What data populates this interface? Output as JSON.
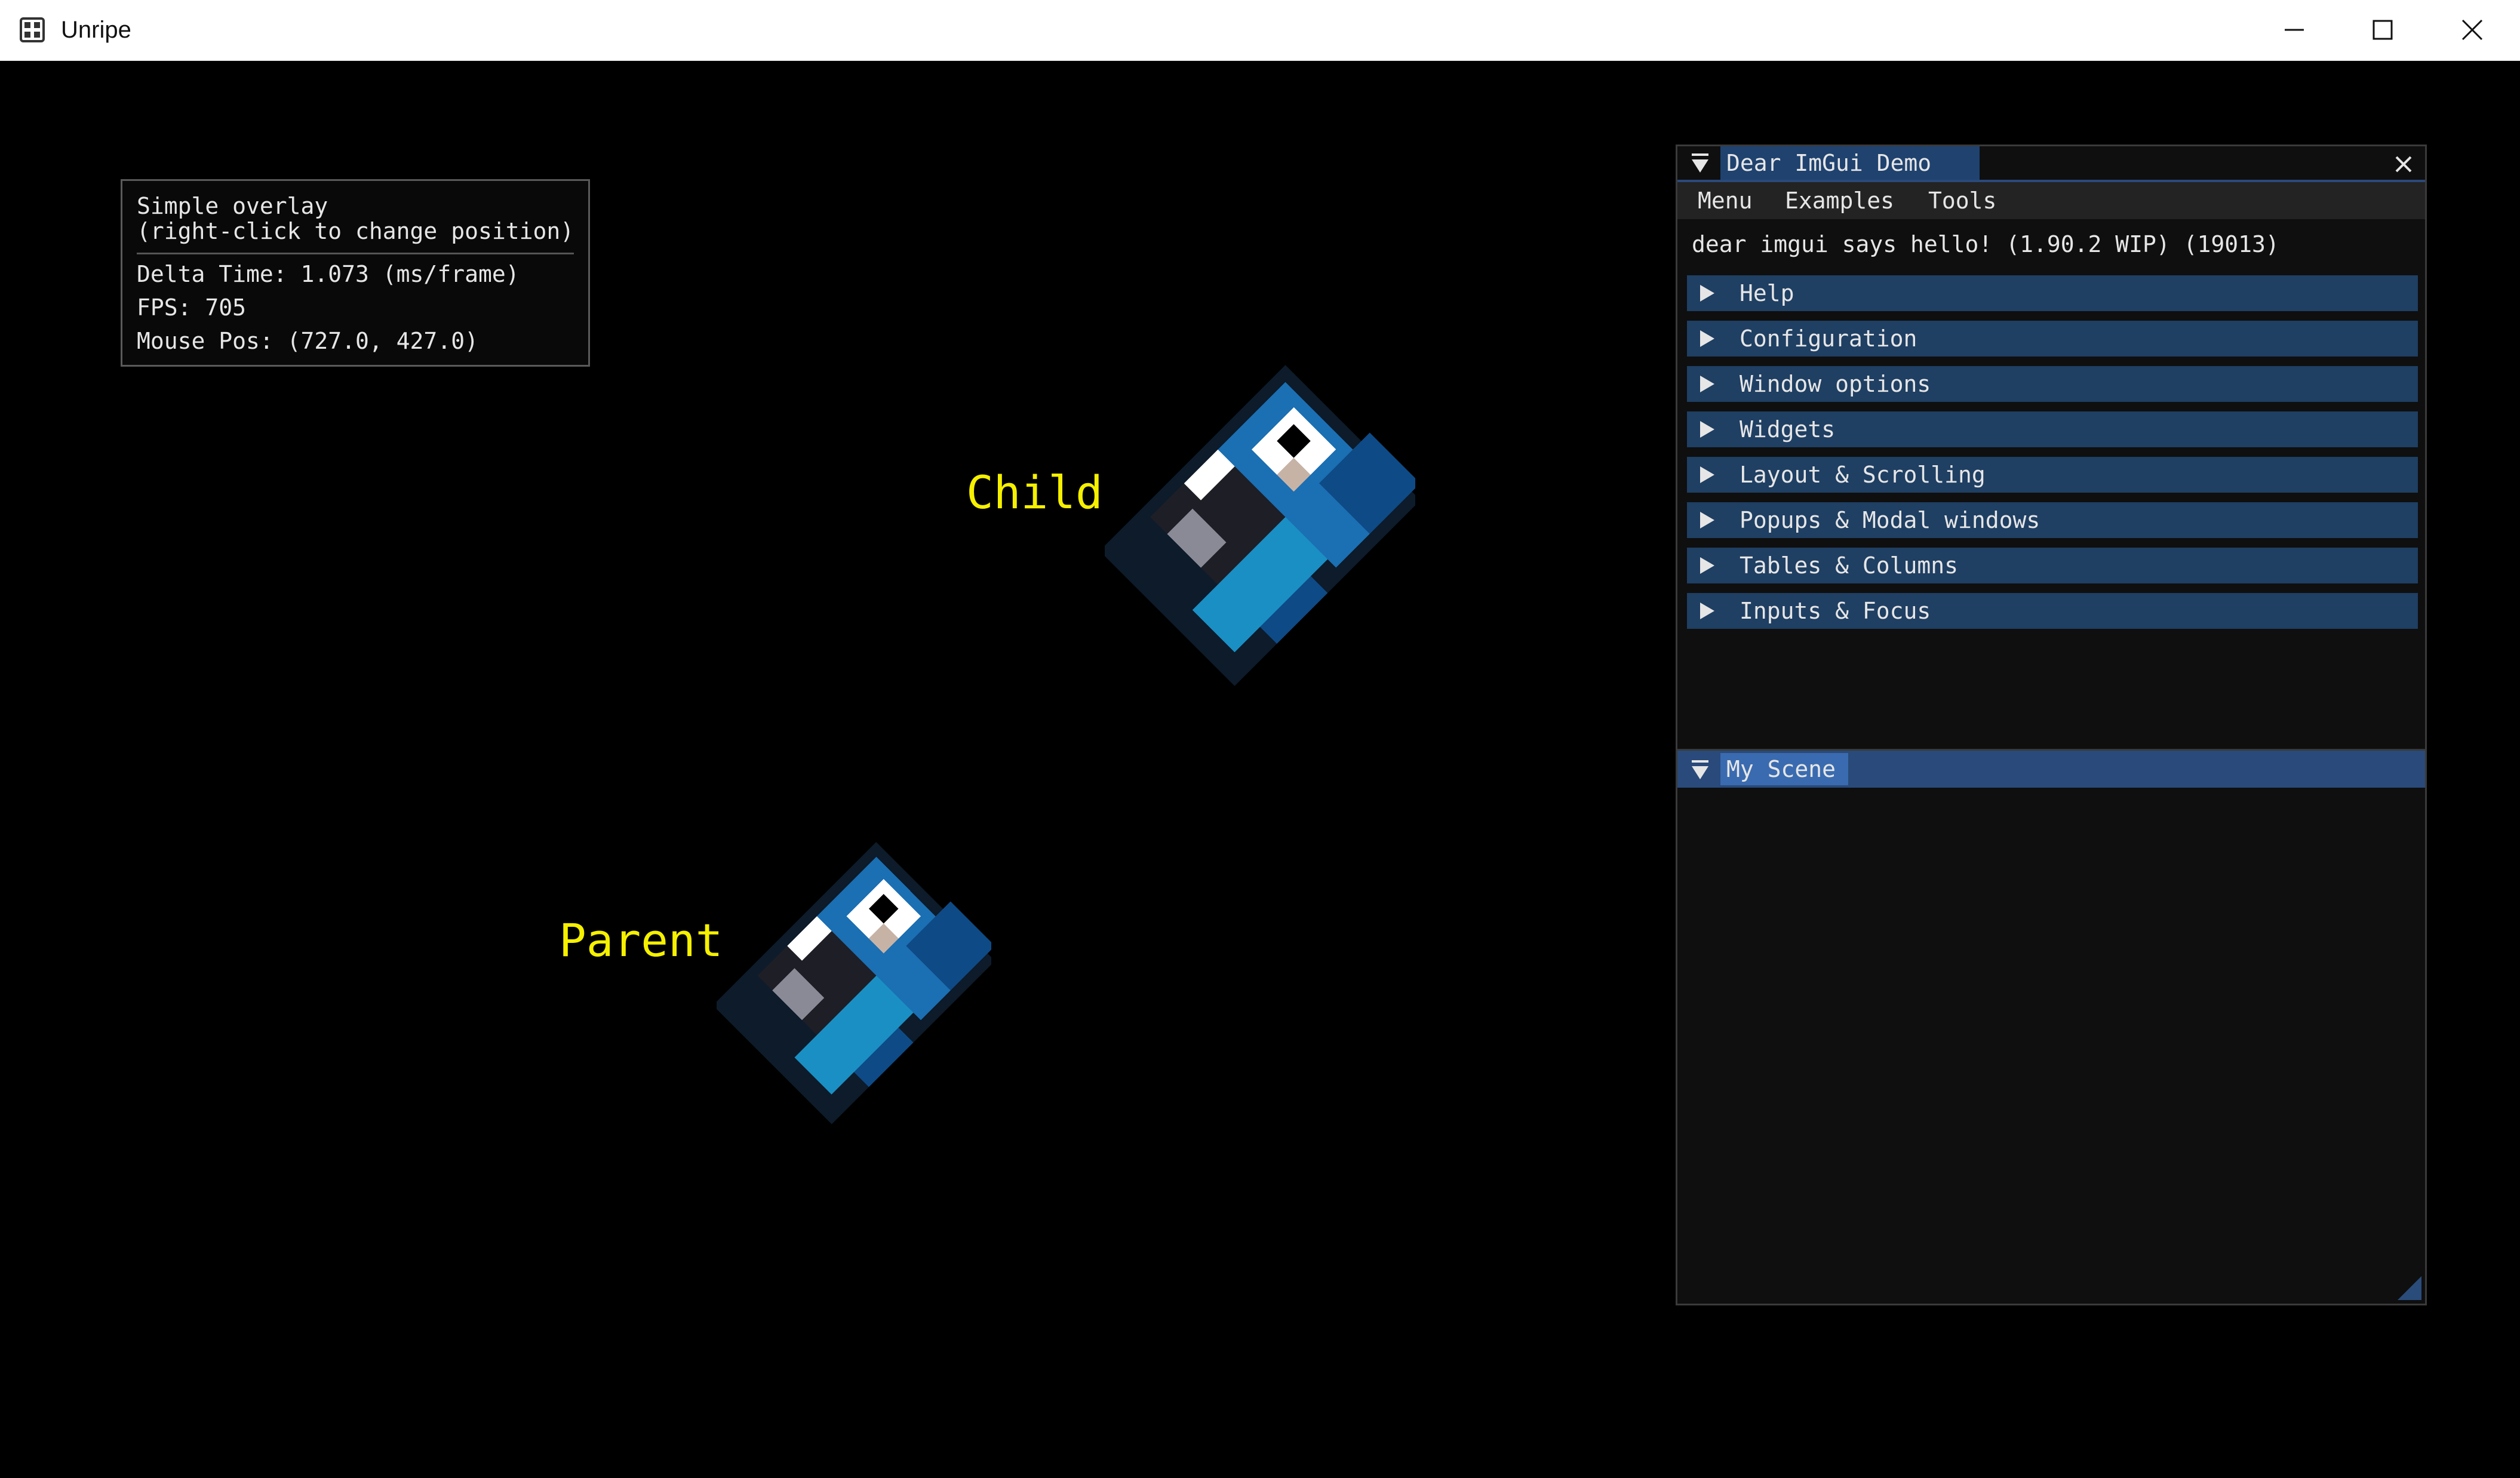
{
  "window": {
    "title": "Unripe",
    "controls": [
      "minimize",
      "maximize",
      "close"
    ]
  },
  "overlay": {
    "line1": "Simple overlay",
    "line2": "(right-click to change position)",
    "delta_time": "Delta Time: 1.073 (ms/frame)",
    "fps": "FPS: 705",
    "mouse_pos": "Mouse Pos: (727.0, 427.0)"
  },
  "scene": {
    "child_label": "Child",
    "parent_label": "Parent"
  },
  "demo": {
    "title": "Dear ImGui Demo",
    "menu": [
      "Menu",
      "Examples",
      "Tools"
    ],
    "hello": "dear imgui says hello! (1.90.2 WIP) (19013)",
    "headers": [
      "Help",
      "Configuration",
      "Window options",
      "Widgets",
      "Layout & Scrolling",
      "Popups & Modal windows",
      "Tables & Columns",
      "Inputs & Focus"
    ]
  },
  "my_scene": {
    "title": "My Scene"
  },
  "colors": {
    "label_yellow": "#f5f000",
    "header_blue": "#1f3f63",
    "tab_blue": "#3a6bb0"
  }
}
